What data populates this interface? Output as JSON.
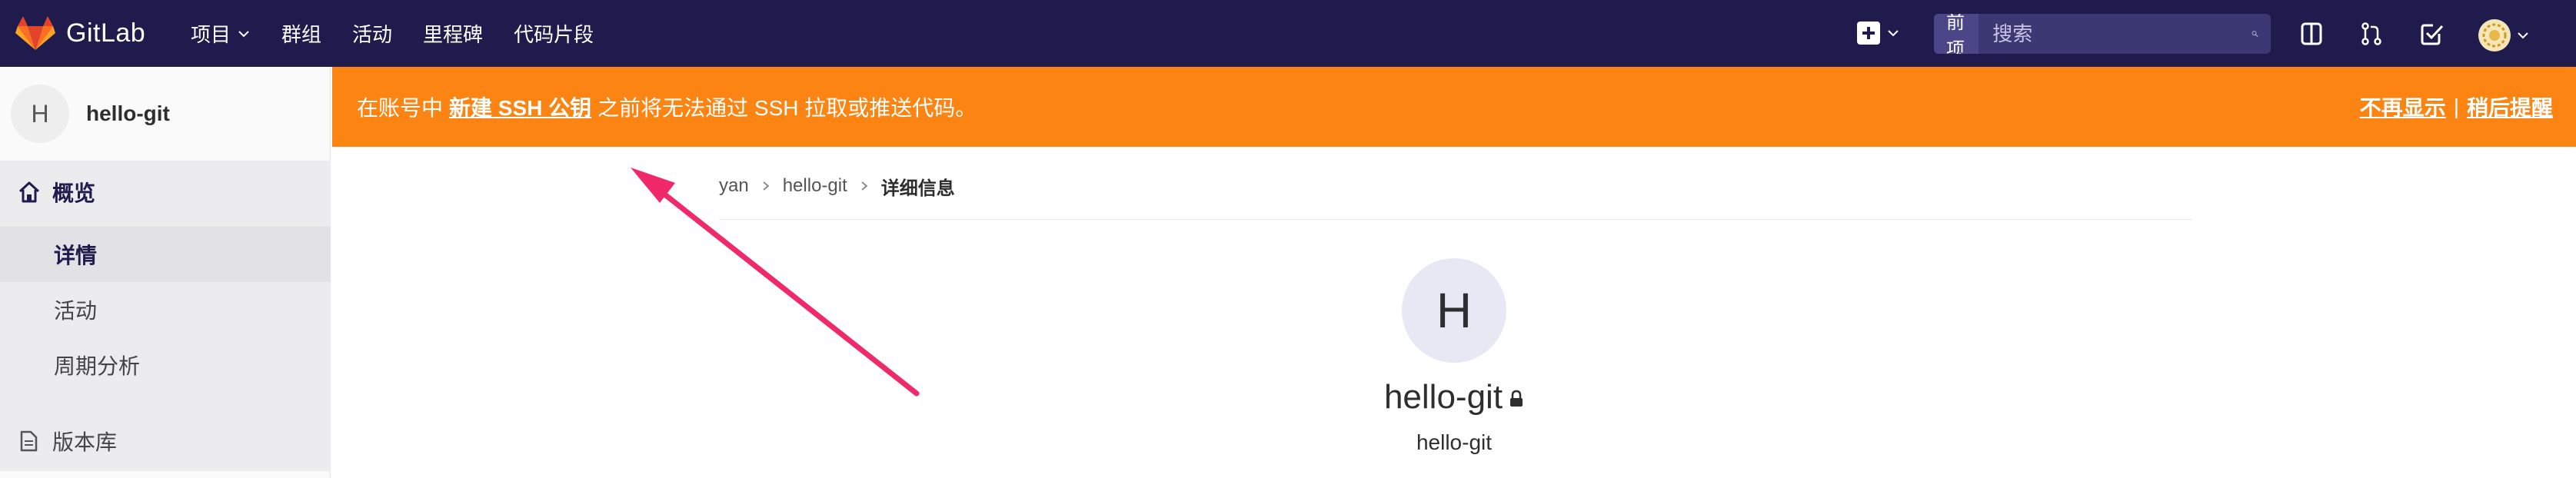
{
  "navbar": {
    "brand": "GitLab",
    "menu": [
      {
        "label": "项目",
        "has_dropdown": true
      },
      {
        "label": "群组",
        "has_dropdown": false
      },
      {
        "label": "活动",
        "has_dropdown": false
      },
      {
        "label": "里程碑",
        "has_dropdown": false
      },
      {
        "label": "代码片段",
        "has_dropdown": false
      }
    ],
    "search": {
      "scope": "当前项目",
      "placeholder": "搜索"
    },
    "icons": [
      "plus-icon",
      "sidebar-toggle-icon",
      "merge-request-icon",
      "todo-check-icon",
      "user-avatar-icon"
    ]
  },
  "sidebar": {
    "project_avatar": "H",
    "project_name": "hello-git",
    "overview_label": "概览",
    "sub_items": [
      "详情",
      "活动",
      "周期分析"
    ],
    "repo_label": "版本库"
  },
  "banner": {
    "prefix": "在账号中",
    "link": "新建 SSH 公钥",
    "suffix": "之前将无法通过 SSH 拉取或推送代码。",
    "dismiss": "不再显示",
    "separator": "|",
    "remind": "稍后提醒",
    "color": "#fc8412"
  },
  "breadcrumb": [
    "yan",
    "hello-git",
    "详细信息"
  ],
  "main": {
    "avatar": "H",
    "title": "hello-git",
    "subtitle": "hello-git"
  },
  "colors": {
    "navbar": "#1f1b4d",
    "annotation_arrow": "#f02a6a"
  }
}
